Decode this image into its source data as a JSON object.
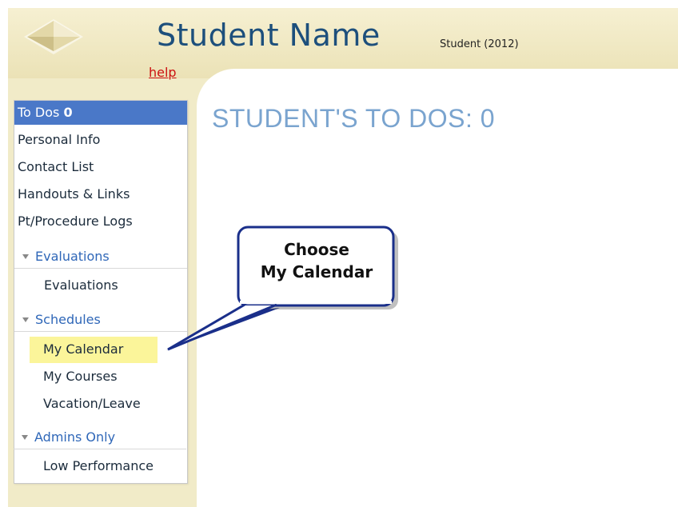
{
  "header": {
    "title": "Student Name",
    "subtitle": "Student (2012)",
    "help_label": "help"
  },
  "main": {
    "heading": "STUDENT'S TO DOS: 0"
  },
  "sidebar": {
    "todos": {
      "label": "To Dos",
      "count": "0"
    },
    "items": [
      {
        "label": "Personal Info"
      },
      {
        "label": "Contact List"
      },
      {
        "label": "Handouts & Links"
      },
      {
        "label": "Pt/Procedure Logs"
      }
    ],
    "sections": [
      {
        "label": "Evaluations",
        "items": [
          {
            "label": "Evaluations"
          }
        ]
      },
      {
        "label": "Schedules",
        "items": [
          {
            "label": "My Calendar"
          },
          {
            "label": "My Courses"
          },
          {
            "label": "Vacation/Leave"
          }
        ]
      },
      {
        "label": "Admins Only",
        "items": [
          {
            "label": "Low Performance"
          }
        ]
      }
    ]
  },
  "callout": {
    "line1": "Choose",
    "line2": "My Calendar"
  },
  "colors": {
    "frame": "#f1ebc8",
    "title": "#1d4f7c",
    "heading": "#7aa4cf",
    "active_item": "#4a78c8",
    "section_link": "#2f67b8",
    "highlight": "#fbf59a",
    "help_link": "#cc1111",
    "callout_border": "#1a2f8a"
  },
  "icons": {
    "logo": "diamond-logo-icon",
    "section_toggle": "caret-down-icon"
  }
}
